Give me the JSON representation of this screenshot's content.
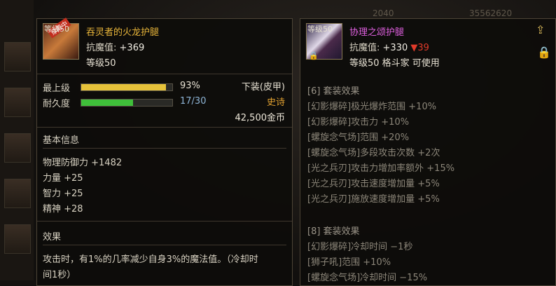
{
  "background": {
    "top_values": [
      "2040",
      "35562620"
    ]
  },
  "left": {
    "level_tag": "等级50",
    "equipped_badge": "穿戴中",
    "name": "吞灵者的火龙护腿",
    "name_color": "#e8b53a",
    "magic_res_label": "抗魔值:",
    "magic_res_value": "+369",
    "required_level": "等级50",
    "upgrade_label": "最上级",
    "upgrade_value": "93%",
    "upgrade_fraction": 0.93,
    "durability_label": "耐久度",
    "durability_value": "17/30",
    "durability_fraction": 0.567,
    "slot_type": "下装(皮甲)",
    "rarity": "史诗",
    "rarity_color": "#e0a030",
    "price": "42,500金币",
    "basic_info_title": "基本信息",
    "stats": [
      "物理防御力 +1482",
      "力量 +25",
      "智力 +25",
      "精神 +28"
    ],
    "effect_title": "效果",
    "effect_line1": "攻击时，有1%的几率减少自身3%的魔法值。（冷却时",
    "effect_line2": "间1秒）"
  },
  "right": {
    "level_tag": "等级50",
    "name": "协理之颂护腿",
    "name_color": "#e060e0",
    "magic_res_label": "抗魔值:",
    "magic_res_value": "+330",
    "magic_res_diff": "▼39",
    "diff_color": "#e03a2a",
    "requirement": "等级50 格斗家 可使用",
    "set6_title": "[6] 套装效果",
    "set6": [
      "[幻影爆碎]极光爆炸范围 +10%",
      "[幻影爆碎]攻击力 +10%",
      "[螺旋念气场]范围 +20%",
      "[螺旋念气场]多段攻击次数 +2次",
      "[光之兵刃]攻击力增加率额外 +15%",
      "[光之兵刃]攻击速度增加量 +5%",
      "[光之兵刃]施放速度增加量 +5%"
    ],
    "set8_title": "[8] 套装效果",
    "set8": [
      "[幻影爆碎]冷却时间 −1秒",
      "[狮子吼]范围 +10%",
      "[螺旋念气场]冷却时间 −15%"
    ]
  }
}
